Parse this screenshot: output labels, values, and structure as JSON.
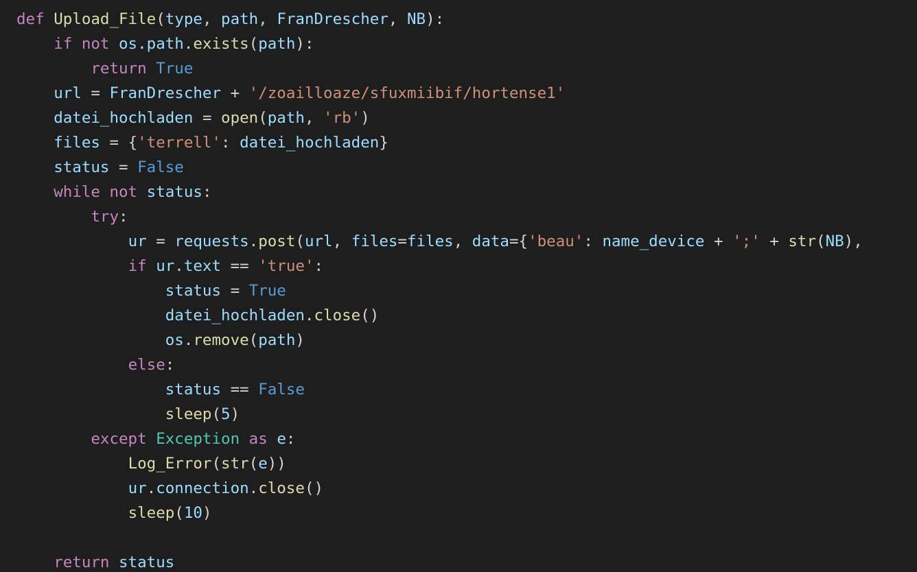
{
  "code": {
    "line1": {
      "def": "def",
      "fn": "Upload_File",
      "p1": "type",
      "p2": "path",
      "p3": "FranDrescher",
      "p4": "NB"
    },
    "line2": {
      "if": "if",
      "not": "not",
      "os": "os",
      "path": "path",
      "exists": "exists",
      "arg": "path"
    },
    "line3": {
      "return": "return",
      "true": "True"
    },
    "line4": {
      "url": "url",
      "rhs": "FranDrescher",
      "plus": "+",
      "str": "'/zoailloaze/sfuxmiibif/hortense1'"
    },
    "line5": {
      "var": "datei_hochladen",
      "open": "open",
      "a1": "path",
      "a2": "'rb'"
    },
    "line6": {
      "var": "files",
      "key": "'terrell'",
      "val": "datei_hochladen"
    },
    "line7": {
      "var": "status",
      "false": "False"
    },
    "line8": {
      "while": "while",
      "not": "not",
      "cond": "status"
    },
    "line9": {
      "try": "try"
    },
    "line10": {
      "ur": "ur",
      "requests": "requests",
      "post": "post",
      "url": "url",
      "files_kw": "files",
      "files_val": "files",
      "data_kw": "data",
      "beau": "'beau'",
      "name_device": "name_device",
      "plus": "+",
      "semi": "';'",
      "str_fn": "str",
      "nb": "NB"
    },
    "line11": {
      "if": "if",
      "ur": "ur",
      "text": "text",
      "eq": "==",
      "true_s": "'true'"
    },
    "line12": {
      "status": "status",
      "true": "True"
    },
    "line13": {
      "var": "datei_hochladen",
      "close": "close"
    },
    "line14": {
      "os": "os",
      "remove": "remove",
      "path": "path"
    },
    "line15": {
      "else": "else"
    },
    "line16": {
      "status": "status",
      "eq": "==",
      "false": "False"
    },
    "line17": {
      "sleep": "sleep",
      "n": "5"
    },
    "line18": {
      "except": "except",
      "exc": "Exception",
      "as": "as",
      "e": "e"
    },
    "line19": {
      "log": "Log_Error",
      "str_fn": "str",
      "e": "e"
    },
    "line20": {
      "ur": "ur",
      "conn": "connection",
      "close": "close"
    },
    "line21": {
      "sleep": "sleep",
      "n": "10"
    },
    "line22": {
      "return": "return",
      "status": "status"
    }
  }
}
